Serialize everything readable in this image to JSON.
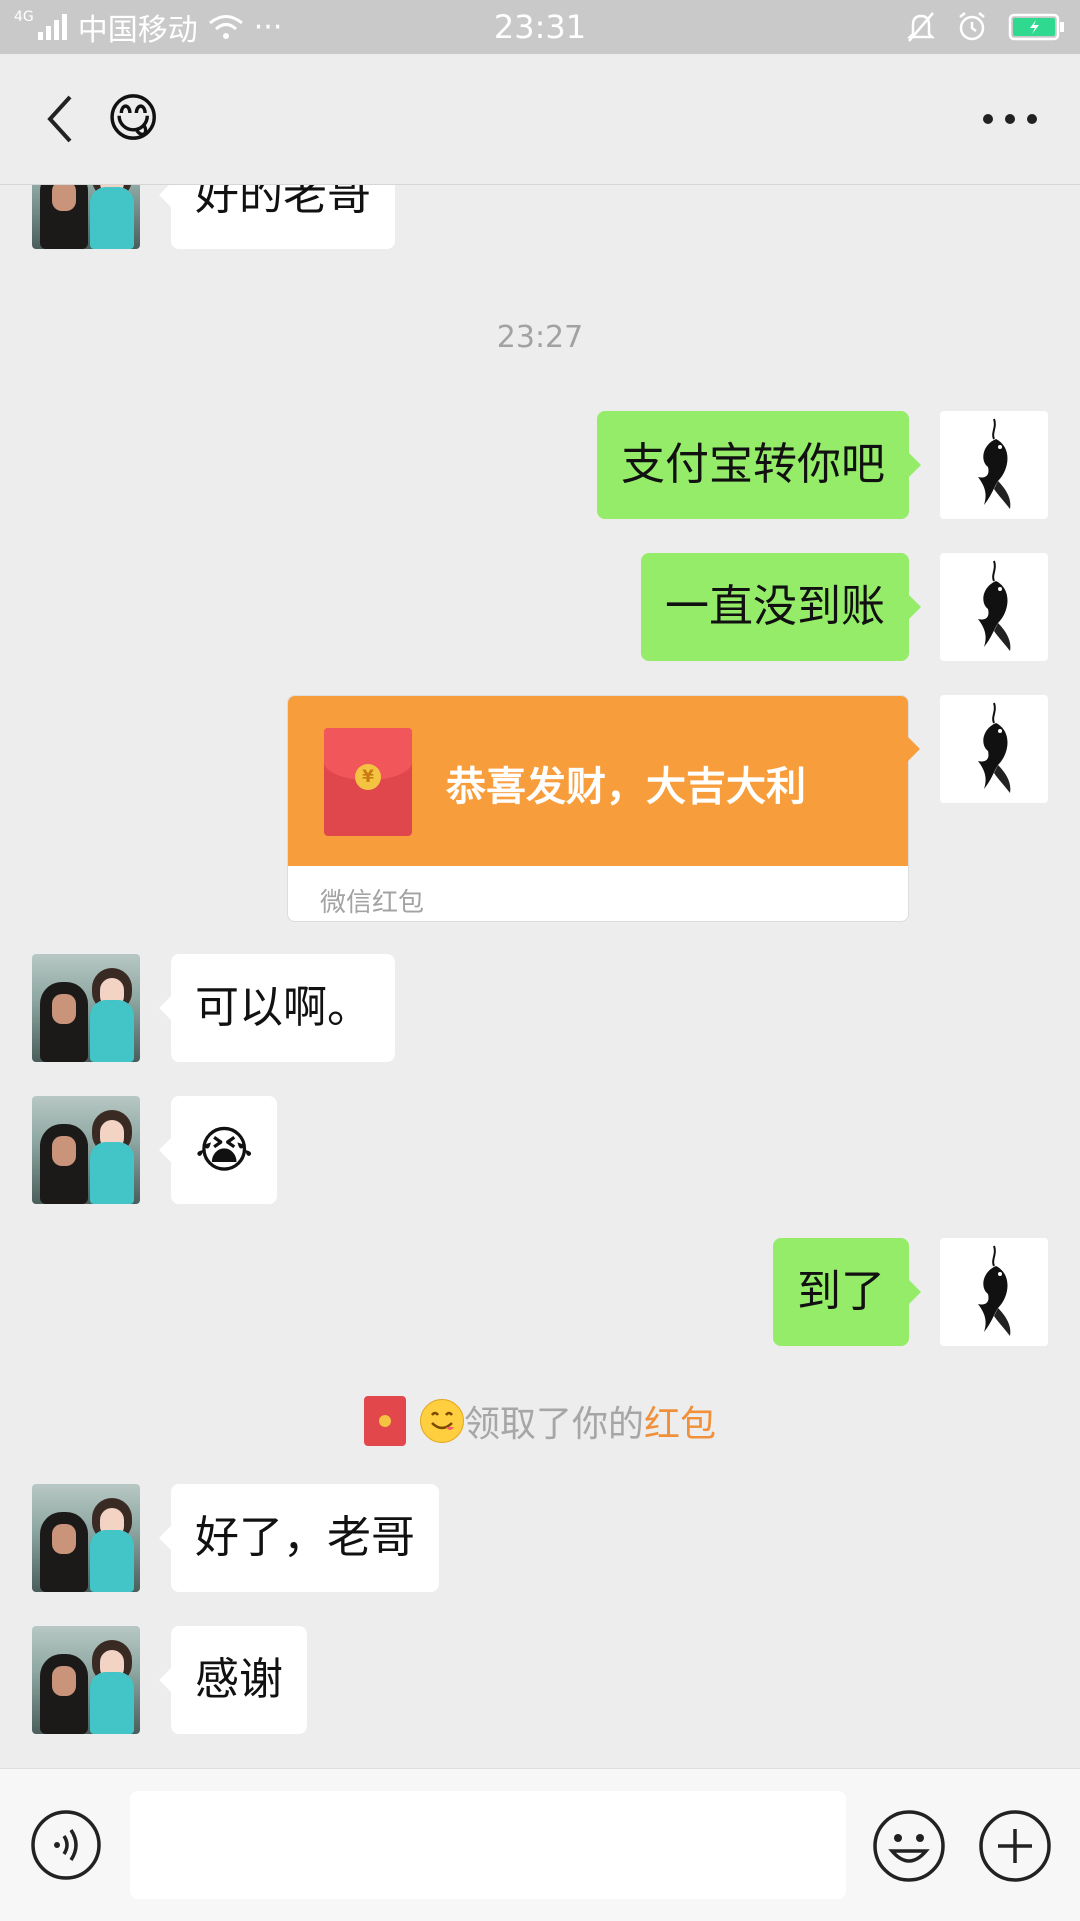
{
  "status_bar": {
    "network": "4G",
    "carrier": "中国移动",
    "more": "···",
    "time": "23:31"
  },
  "nav": {
    "title_emoji": "😋"
  },
  "messages": [
    {
      "from": "other",
      "type": "text",
      "text": "好的老哥"
    },
    {
      "type": "timestamp",
      "text": "23:27"
    },
    {
      "from": "me",
      "type": "text",
      "text": "支付宝转你吧"
    },
    {
      "from": "me",
      "type": "text",
      "text": "一直没到账"
    },
    {
      "from": "me",
      "type": "red_packet",
      "title": "恭喜发财，大吉大利",
      "footer": "微信红包",
      "coin": "¥"
    },
    {
      "from": "other",
      "type": "text",
      "text": "可以啊。"
    },
    {
      "from": "other",
      "type": "emoji",
      "text": "😭"
    },
    {
      "from": "me",
      "type": "text",
      "text": "到了"
    },
    {
      "type": "system",
      "prefix": "领取了你的",
      "highlight": "红包"
    },
    {
      "from": "other",
      "type": "text",
      "text": "好了，老哥"
    },
    {
      "from": "other",
      "type": "text",
      "text": "感谢"
    }
  ],
  "colors": {
    "my_bubble": "#95ec69",
    "red_packet": "#f89d3b",
    "background": "#ededed",
    "highlight": "#f0903a"
  }
}
